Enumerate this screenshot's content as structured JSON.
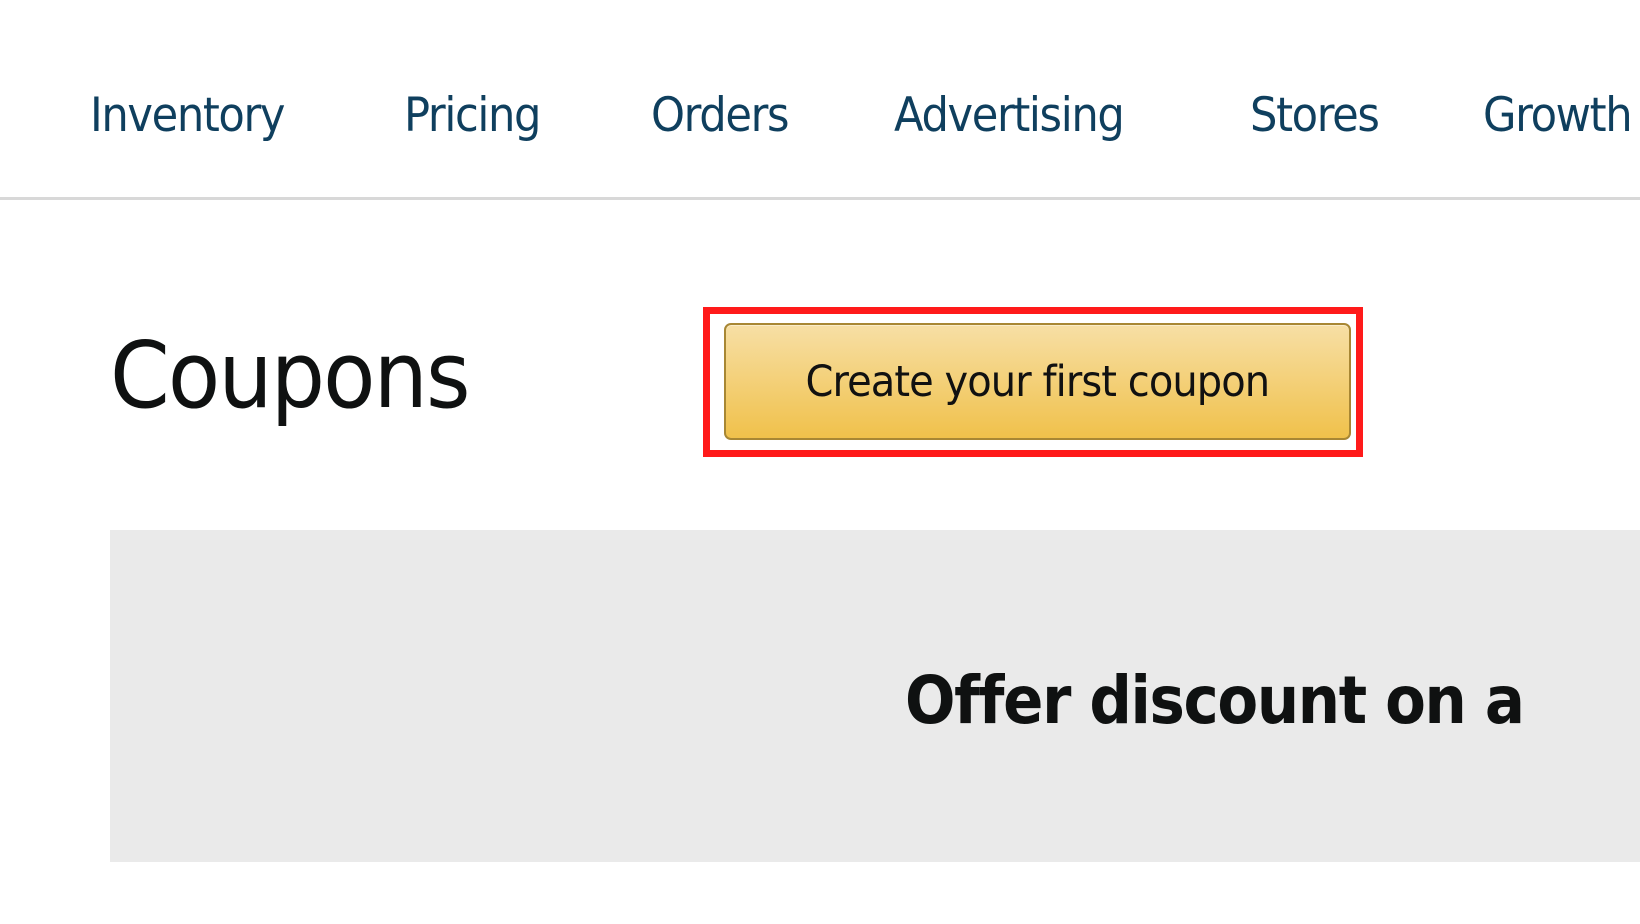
{
  "nav": {
    "items": [
      {
        "label": "Inventory"
      },
      {
        "label": "Pricing"
      },
      {
        "label": "Orders"
      },
      {
        "label": "Advertising"
      },
      {
        "label": "Stores"
      },
      {
        "label": "Growth"
      }
    ]
  },
  "page": {
    "title": "Coupons",
    "create_button_label": "Create your first coupon"
  },
  "promo": {
    "heading": "Offer discount on a"
  },
  "colors": {
    "nav_text": "#0f3f5e",
    "button_gradient_top": "#f7dfa5",
    "button_gradient_bottom": "#f0c14b",
    "highlight": "#ff1a1a",
    "panel_bg": "#eaeaea"
  }
}
